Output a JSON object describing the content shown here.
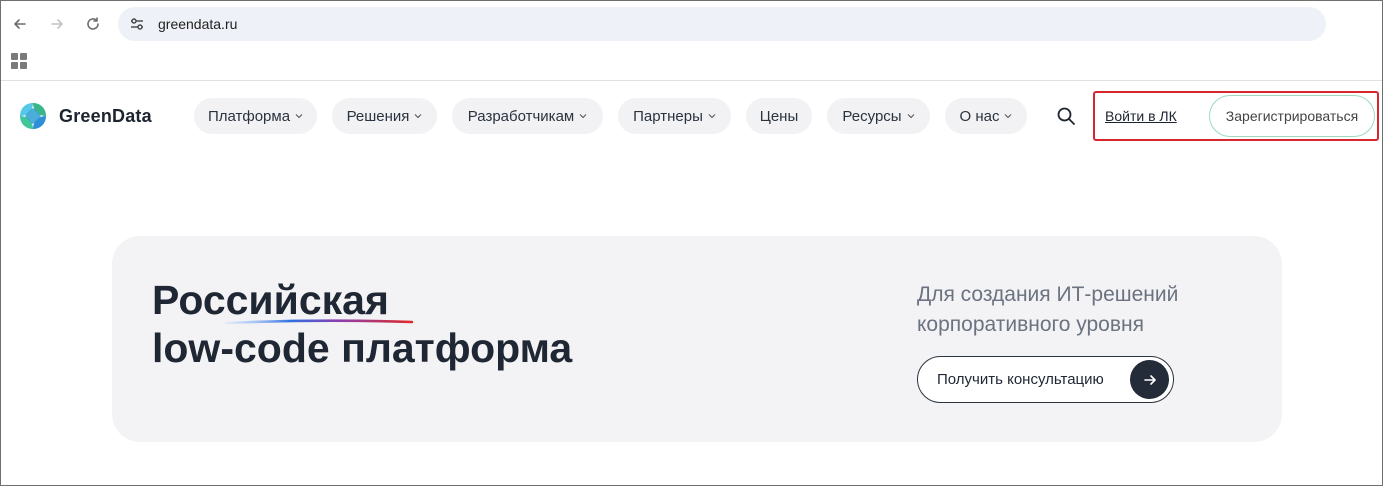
{
  "browser": {
    "url": "greendata.ru",
    "icons": [
      "back-arrow-icon",
      "forward-arrow-icon",
      "reload-icon",
      "site-settings-icon",
      "apps-grid-icon"
    ]
  },
  "header": {
    "brand": "GreenData",
    "menu": [
      {
        "label": "Платформа",
        "dropdown": true
      },
      {
        "label": "Решения",
        "dropdown": true
      },
      {
        "label": "Разработчикам",
        "dropdown": true
      },
      {
        "label": "Партнеры",
        "dropdown": true
      },
      {
        "label": "Цены",
        "dropdown": false
      },
      {
        "label": "Ресурсы",
        "dropdown": true
      },
      {
        "label": "О нас",
        "dropdown": true
      }
    ],
    "login": "Войти в ЛК",
    "register": "Зарегистрироваться"
  },
  "hero": {
    "title_line1": "Российская",
    "title_line2": "low-code платформа",
    "subtitle_line1": "Для создания ИТ-решений",
    "subtitle_line2": "корпоративного уровня",
    "cta": "Получить консультацию"
  },
  "colors": {
    "highlight_box": "#d9262e",
    "register_border": "#9fd9bd",
    "hero_bg": "#f3f3f5",
    "cta_arrow_bg": "#232c38",
    "underline_blue": "#2f6fe0",
    "underline_red": "#e02b2b"
  }
}
